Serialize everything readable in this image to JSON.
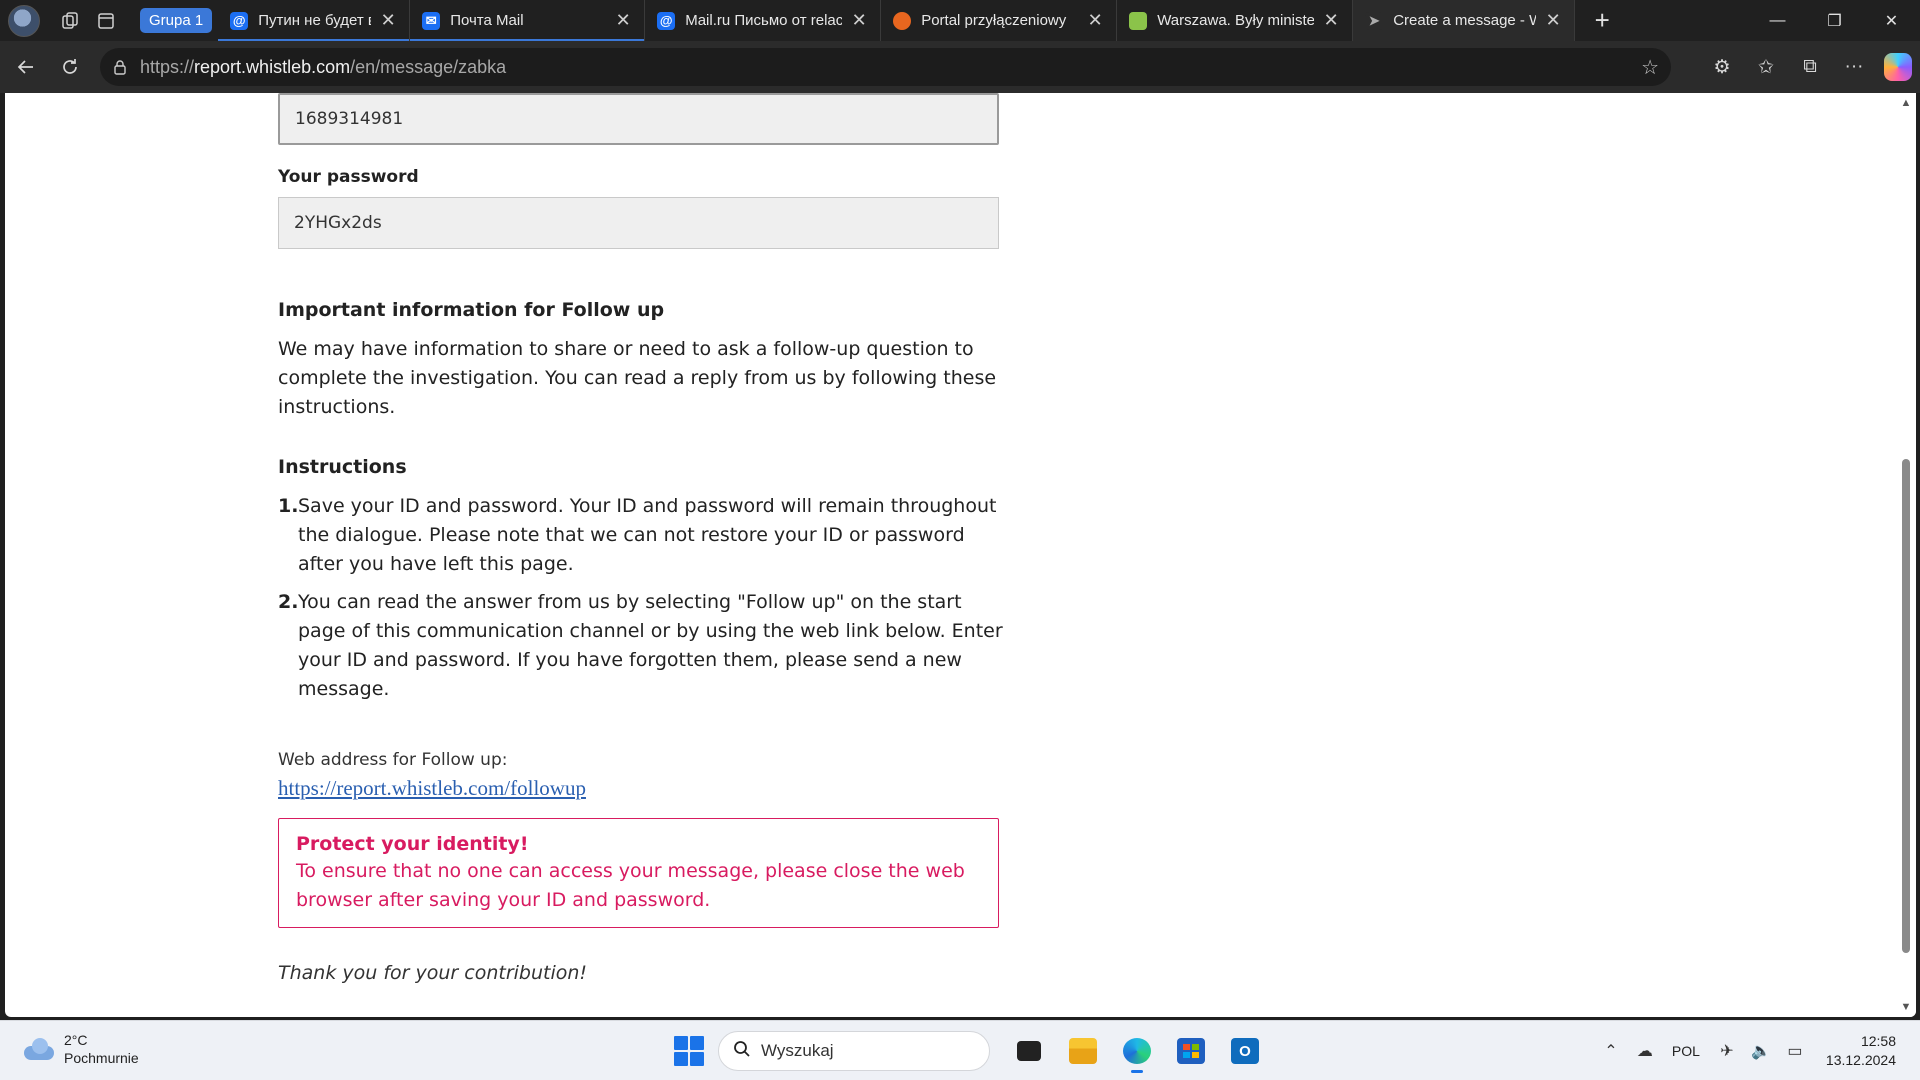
{
  "browser": {
    "group_label": "Grupa 1",
    "tabs": [
      {
        "title": "Путин не будет встречать",
        "favicon": "at-sign-icon",
        "color": "#1b6ef3",
        "active": false,
        "grouped": true
      },
      {
        "title": "Почта Mail",
        "favicon": "mail-icon",
        "color": "#1b6ef3",
        "active": false,
        "grouped": true
      },
      {
        "title": "Mail.ru Письмо от relac",
        "favicon": "at-sign-icon",
        "color": "#1b6ef3",
        "active": false,
        "grouped": false
      },
      {
        "title": "Portal przyłączeniowy",
        "favicon": "flame-icon",
        "color": "#e8661f",
        "active": false,
        "grouped": false
      },
      {
        "title": "Warszawa. Były minister",
        "favicon": "news-icon",
        "color": "#8bc34a",
        "active": false,
        "grouped": false
      },
      {
        "title": "Create a message - Whi",
        "favicon": "bird-icon",
        "color": "#444444",
        "active": true,
        "grouped": false
      }
    ],
    "address": {
      "scheme": "https://",
      "host": "report.whistleb.com",
      "path": "/en/message/zabka"
    }
  },
  "page": {
    "id_value": "1689314981",
    "password_label": "Your password",
    "password_value": "2YHGx2ds",
    "followup_heading": "Important information for Follow up",
    "followup_text": "We may have information to share or need to ask a follow-up question to complete the investigation. You can read a reply from us by following these instructions.",
    "instructions_heading": "Instructions",
    "instructions": [
      {
        "num": "1.",
        "text": "Save your ID and password. Your ID and password will remain throughout the dialogue. Please note that we can not restore your ID or password after you have left this page."
      },
      {
        "num": "2.",
        "text": "You can read the answer from us by selecting \"Follow up\" on the start page of this communication channel or by using the web link below. Enter your ID and password. If you have forgotten them, please send a new message."
      }
    ],
    "web_address_label": "Web address for Follow up:",
    "web_address_link": "https://report.whistleb.com/followup",
    "alert_title": "Protect your identity!",
    "alert_text": "To ensure that no one can access your message, please close the web browser after saving your ID and password.",
    "thanks": "Thank you for your contribution!"
  },
  "taskbar": {
    "weather_temp": "2°C",
    "weather_desc": "Pochmurnie",
    "search_placeholder": "Wyszukaj",
    "language": "POL",
    "time": "12:58",
    "date": "13.12.2024"
  },
  "colors": {
    "alert": "#d81b60",
    "link": "#2a5fb0",
    "accent": "#1a73e8"
  }
}
